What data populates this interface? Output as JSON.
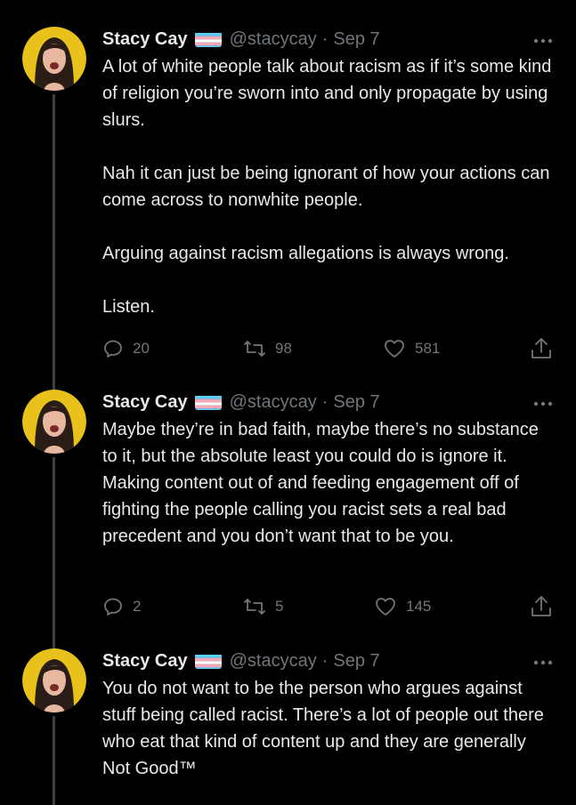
{
  "tweets": [
    {
      "author": {
        "name": "Stacy Cay",
        "handle": "@stacycay",
        "flag": "transgender-flag"
      },
      "date": "Sep 7",
      "paragraphs": [
        "A lot of white people talk about racism as if it’s some kind of religion you’re sworn into and only propagate by using slurs.",
        "Nah it can just be being ignorant of how your actions can come across to nonwhite people.",
        "Arguing against racism allegations is always wrong.",
        "Listen."
      ],
      "replies": "20",
      "retweets": "98",
      "likes": "581"
    },
    {
      "author": {
        "name": "Stacy Cay",
        "handle": "@stacycay",
        "flag": "transgender-flag"
      },
      "date": "Sep 7",
      "paragraphs": [
        "Maybe they’re in bad faith, maybe there’s no substance to it, but the absolute least you could do is ignore it. Making content out of and feeding engagement off of fighting the people calling you racist sets a real bad precedent and you don’t want that to be you."
      ],
      "replies": "2",
      "retweets": "5",
      "likes": "145"
    },
    {
      "author": {
        "name": "Stacy Cay",
        "handle": "@stacycay",
        "flag": "transgender-flag"
      },
      "date": "Sep 7",
      "paragraphs": [
        "You do not want to be the person who argues against stuff being called racist. There’s a lot of people out there who eat that kind of content up and they are generally Not Good™"
      ]
    }
  ],
  "colors": {
    "background": "#000000",
    "text": "#e7e9ea",
    "muted": "#71767b",
    "thread_line": "#3e4144",
    "avatar_bg": "#e8c11a"
  },
  "icons": [
    "reply-icon",
    "retweet-icon",
    "like-icon",
    "share-icon",
    "more-options-icon",
    "transgender-flag-icon"
  ]
}
